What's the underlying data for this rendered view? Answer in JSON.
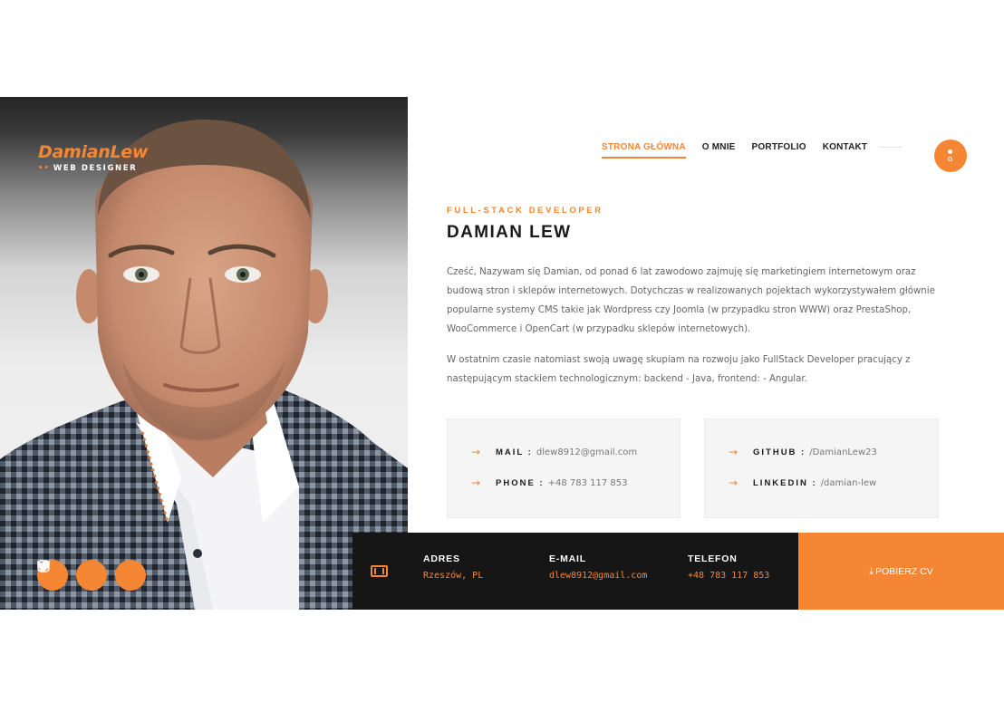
{
  "brand": {
    "name": "DamianLew",
    "dots": "••",
    "tagline": "WEB DESIGNER"
  },
  "nav": {
    "items": [
      {
        "label": "STRONA GŁÓWNA",
        "active": true
      },
      {
        "label": "O MNIE"
      },
      {
        "label": "PORTFOLIO"
      },
      {
        "label": "KONTAKT"
      }
    ]
  },
  "intro": {
    "kicker": "FULL-STACK DEVELOPER",
    "title": "DAMIAN LEW",
    "paragraph1": "Cześć, Nazywam się Damian, od ponad 6 lat zawodowo zajmuję się marketingiem internetowym oraz budową stron i sklepów internetowych. Dotychczas w realizowanych pojektach wykorzystywałem głównie popularne systemy CMS takie jak Wordpress czy Joomla (w przypadku stron WWW) oraz PrestaShop, WooCommerce i OpenCart (w przypadku sklepów internetowych).",
    "paragraph2": "W ostatnim czasie natomiast swoją uwagę skupiam na rozwoju jako FullStack Developer pracujący z następującym stackiem technologicznym: backend - Java, frontend: - Angular."
  },
  "contacts": {
    "left": [
      {
        "label": "MAIL :",
        "value": "dlew8912@gmail.com"
      },
      {
        "label": "PHONE :",
        "value": "+48 783 117 853"
      }
    ],
    "right": [
      {
        "label": "GITHUB :",
        "value": "/DamianLew23"
      },
      {
        "label": "LINKEDIN :",
        "value": "/damian-lew"
      }
    ]
  },
  "bar": {
    "address": {
      "heading": "ADRES",
      "value": "Rzeszów, PL"
    },
    "email": {
      "heading": "E-MAIL",
      "value": "dlew8912@gmail.com"
    },
    "phone": {
      "heading": "TELEFON",
      "value": "+48 783 117 853"
    }
  },
  "cv": {
    "icon": "⤓",
    "label": "POBIERZ CV"
  },
  "socials": [
    "facebook-icon",
    "twitter-icon",
    "instagram-icon"
  ],
  "colors": {
    "accent": "#f58634",
    "dark": "#161616",
    "box": "#f5f5f5"
  }
}
